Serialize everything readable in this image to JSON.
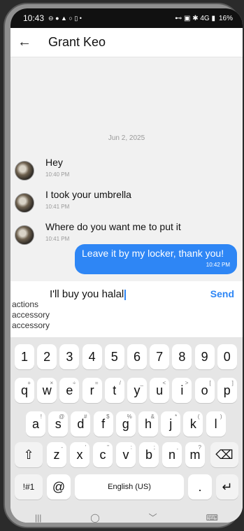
{
  "status_bar": {
    "time": "10:43",
    "left_icons": "⊖ ● ▲ ○ ▯ •",
    "right_icons": "⊷ ▣ ✱ 4G ▮",
    "battery": "16%"
  },
  "header": {
    "back_icon": "arrow-left-icon",
    "contact_name": "Grant Keo"
  },
  "chat": {
    "date_separator": "Jun 2, 2025",
    "messages": [
      {
        "text": "Hey",
        "time": "10:40 PM"
      },
      {
        "text": "I took your umbrella",
        "time": "10:41 PM"
      },
      {
        "text": "Where do you want me to put it",
        "time": "10:41 PM"
      }
    ],
    "outgoing": {
      "text": "Leave it by my locker, thank you!",
      "time": "10:42 PM"
    }
  },
  "compose": {
    "text": "I'll buy you halal",
    "send_label": "Send",
    "suggestions": [
      "actions",
      "accessory",
      "accessory"
    ]
  },
  "keyboard": {
    "row_numbers": [
      "1",
      "2",
      "3",
      "4",
      "5",
      "6",
      "7",
      "8",
      "9",
      "0"
    ],
    "row1": [
      {
        "k": "q",
        "s": "+"
      },
      {
        "k": "w",
        "s": "×"
      },
      {
        "k": "e",
        "s": "÷"
      },
      {
        "k": "r",
        "s": "="
      },
      {
        "k": "t",
        "s": "/"
      },
      {
        "k": "y",
        "s": "_"
      },
      {
        "k": "u",
        "s": "<"
      },
      {
        "k": "i",
        "s": ">"
      },
      {
        "k": "o",
        "s": "["
      },
      {
        "k": "p",
        "s": "]"
      }
    ],
    "row2": [
      {
        "k": "a",
        "s": "!"
      },
      {
        "k": "s",
        "s": "@"
      },
      {
        "k": "d",
        "s": "#"
      },
      {
        "k": "f",
        "s": "$"
      },
      {
        "k": "g",
        "s": "%"
      },
      {
        "k": "h",
        "s": "&"
      },
      {
        "k": "j",
        "s": "*"
      },
      {
        "k": "k",
        "s": "("
      },
      {
        "k": "l",
        "s": ")"
      }
    ],
    "row3": [
      {
        "k": "z",
        "s": "-"
      },
      {
        "k": "x",
        "s": "'"
      },
      {
        "k": "c",
        "s": "\""
      },
      {
        "k": "v",
        "s": ":"
      },
      {
        "k": "b",
        "s": ";"
      },
      {
        "k": "n",
        "s": ","
      },
      {
        "k": "m",
        "s": "?"
      }
    ],
    "shift_icon": "⇧",
    "delete_icon": "⌫",
    "symbols_label": "!#1",
    "at_label": "@",
    "space_label": "English (US)",
    "period_label": ".",
    "enter_icon": "↵"
  },
  "navbar": {
    "recents": "|||",
    "home": "◯",
    "back": "﹀",
    "keyboard": "⌨"
  }
}
